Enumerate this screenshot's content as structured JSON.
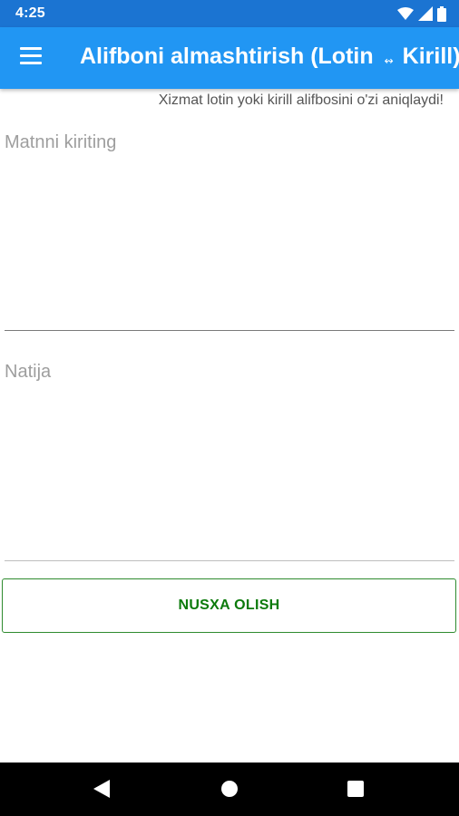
{
  "status_bar": {
    "time": "4:25",
    "icons": [
      "wifi-icon",
      "cell-signal-icon",
      "battery-icon"
    ]
  },
  "app_bar": {
    "menu_icon": "hamburger-menu-icon",
    "title_part1": "Alifboni almashtirish (Lotin",
    "arrow": "↭",
    "title_part2": "Kirill)",
    "background_color": "#2196f3"
  },
  "hint_text": "Xizmat lotin yoki kirill alifbosini o'zi aniqlaydi!",
  "input": {
    "placeholder": "Matnni kiriting",
    "value": ""
  },
  "output": {
    "placeholder": "Natija",
    "value": ""
  },
  "copy_button": {
    "label": "NUSXA OLISH",
    "color": "#0b7a0b"
  },
  "nav_bar": {
    "icons": [
      "back-icon",
      "home-icon",
      "recents-icon"
    ]
  }
}
